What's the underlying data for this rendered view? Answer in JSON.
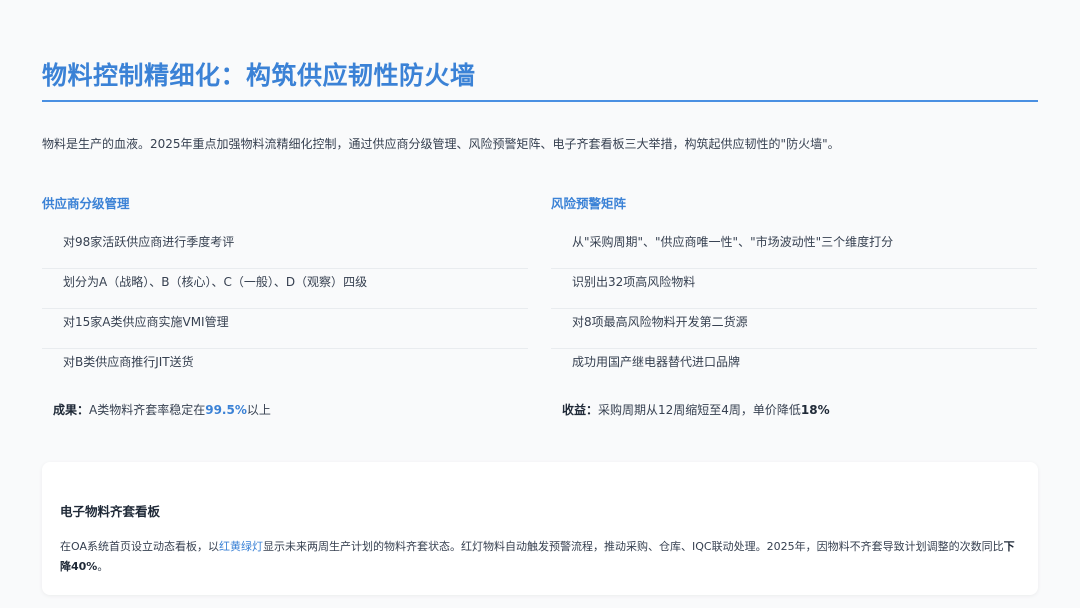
{
  "page": {
    "title": "物料控制精细化：构筑供应韧性防火墙",
    "intro": "物料是生产的血液。2025年重点加强物料流精细化控制，通过供应商分级管理、风险预警矩阵、电子齐套看板三大举措，构筑起供应韧性的\"防火墙\"。"
  },
  "supplier": {
    "heading": "供应商分级管理",
    "items": [
      "对98家活跃供应商进行季度考评",
      "划分为A（战略）、B（核心）、C（一般）、D（观察）四级",
      "对15家A类供应商实施VMI管理",
      "对B类供应商推行JIT送货"
    ],
    "summary": {
      "label": "成果：",
      "text_before": "A类物料齐套率稳定在",
      "highlight": "99.5%",
      "text_after": "以上"
    }
  },
  "risk": {
    "heading": "风险预警矩阵",
    "items": [
      "从\"采购周期\"、\"供应商唯一性\"、\"市场波动性\"三个维度打分",
      "识别出32项高风险物料",
      "对8项最高风险物料开发第二货源",
      "成功用国产继电器替代进口品牌"
    ],
    "summary": {
      "label": "收益：",
      "text_before": "采购周期从12周缩短至4周，单价降低",
      "highlight": "18%"
    }
  },
  "board": {
    "title": "电子物料齐套看板",
    "text_1": "在OA系统首页设立动态看板，以",
    "highlight": "红黄绿灯",
    "text_2": "显示未来两周生产计划的物料齐套状态。红灯物料自动触发预警流程，推动采购、仓库、IQC联动处理。2025年，因物料不齐套导致计划调整的次数同比",
    "strong": "下降40%",
    "end": "。"
  },
  "colors": {
    "accent": "#3b82d6",
    "rule": "#4a90e2",
    "text": "#374151",
    "background": "#f9fafb"
  }
}
